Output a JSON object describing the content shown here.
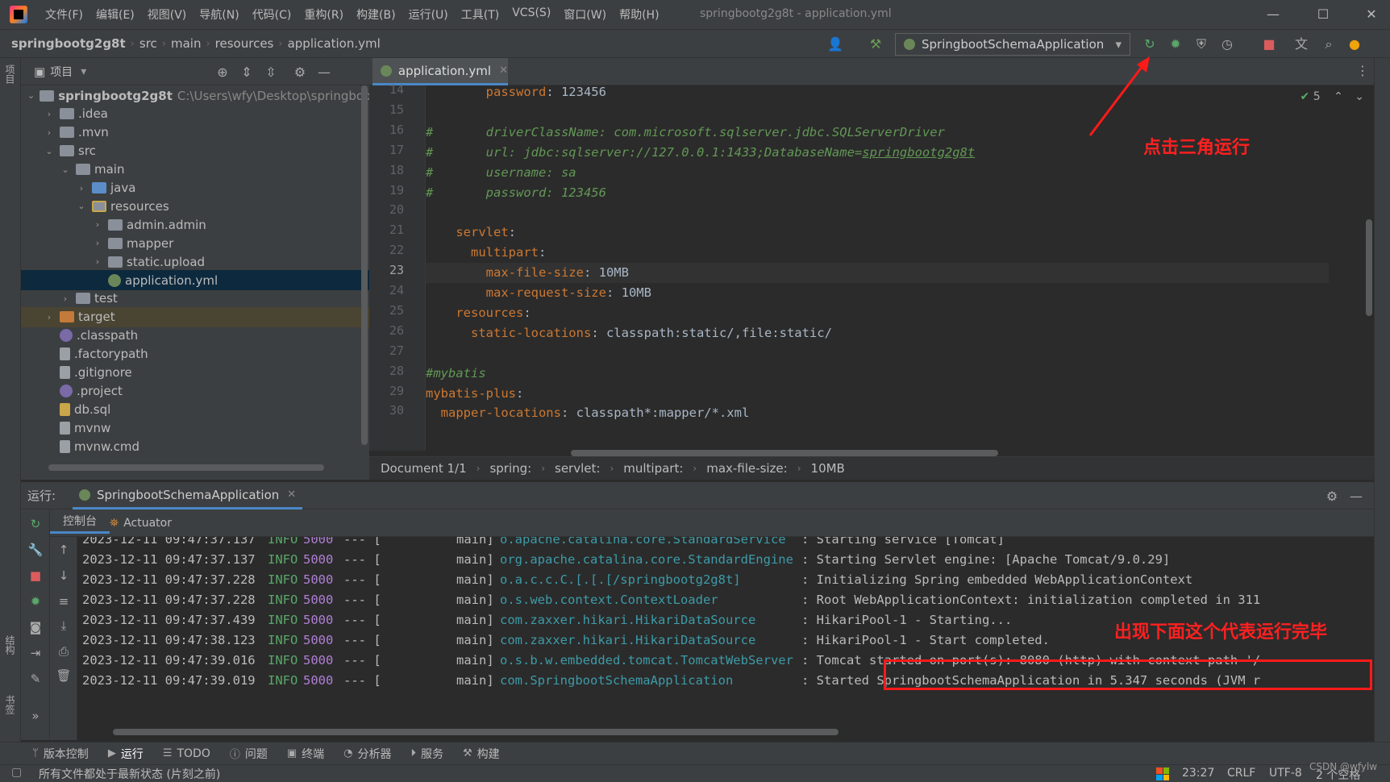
{
  "menu": {
    "items": [
      "文件(F)",
      "编辑(E)",
      "视图(V)",
      "导航(N)",
      "代码(C)",
      "重构(R)",
      "构建(B)",
      "运行(U)",
      "工具(T)",
      "VCS(S)",
      "窗口(W)",
      "帮助(H)"
    ],
    "window_title": "springbootg2g8t - application.yml"
  },
  "nav": {
    "crumbs": [
      "springbootg2g8t",
      "src",
      "main",
      "resources",
      "application.yml"
    ],
    "run_config": "SpringbootSchemaApplication"
  },
  "left_strip": {
    "tabs": [
      "项目",
      "结构",
      "书签"
    ]
  },
  "project": {
    "header": "项目",
    "tree": [
      {
        "label": "springbootg2g8t",
        "hint": "C:\\Users\\wfy\\Desktop\\springboot",
        "depth": 0,
        "open": true,
        "icon": "folder"
      },
      {
        "label": ".idea",
        "depth": 1,
        "open": false,
        "icon": "folder"
      },
      {
        "label": ".mvn",
        "depth": 1,
        "open": false,
        "icon": "folder"
      },
      {
        "label": "src",
        "depth": 1,
        "open": true,
        "icon": "folder"
      },
      {
        "label": "main",
        "depth": 2,
        "open": true,
        "icon": "folder"
      },
      {
        "label": "java",
        "depth": 3,
        "open": false,
        "icon": "folder-blue"
      },
      {
        "label": "resources",
        "depth": 3,
        "open": true,
        "icon": "folder-res"
      },
      {
        "label": "admin.admin",
        "depth": 4,
        "open": false,
        "icon": "folder"
      },
      {
        "label": "mapper",
        "depth": 4,
        "open": false,
        "icon": "folder"
      },
      {
        "label": "static.upload",
        "depth": 4,
        "open": false,
        "icon": "folder"
      },
      {
        "label": "application.yml",
        "depth": 4,
        "open": null,
        "icon": "file-yml",
        "selected": true
      },
      {
        "label": "test",
        "depth": 2,
        "open": false,
        "icon": "folder"
      },
      {
        "label": "target",
        "depth": 1,
        "open": false,
        "icon": "folder-orange",
        "highlight": true
      },
      {
        "label": ".classpath",
        "depth": 1,
        "open": null,
        "icon": "file-eclipse"
      },
      {
        "label": ".factorypath",
        "depth": 1,
        "open": null,
        "icon": "file-gen"
      },
      {
        "label": ".gitignore",
        "depth": 1,
        "open": null,
        "icon": "file-gen"
      },
      {
        "label": ".project",
        "depth": 1,
        "open": null,
        "icon": "file-eclipse"
      },
      {
        "label": "db.sql",
        "depth": 1,
        "open": null,
        "icon": "file-sql"
      },
      {
        "label": "mvnw",
        "depth": 1,
        "open": null,
        "icon": "file-gen"
      },
      {
        "label": "mvnw.cmd",
        "depth": 1,
        "open": null,
        "icon": "file-gen"
      }
    ]
  },
  "editor": {
    "tab": "application.yml",
    "inspection_count": "5",
    "lines": [
      {
        "n": "14",
        "parts": [
          [
            "k",
            "        password"
          ],
          [
            "v",
            ": 123456"
          ]
        ]
      },
      {
        "n": "15",
        "parts": []
      },
      {
        "n": "16",
        "parts": [
          [
            "c",
            "#       driverClassName: com.microsoft.sqlserver.jdbc.SQLServerDriver"
          ]
        ]
      },
      {
        "n": "17",
        "parts": [
          [
            "c",
            "#       url: jdbc:sqlserver://127.0.0.1:1433;DatabaseName="
          ],
          [
            "cu",
            "springbootg2g8t"
          ]
        ]
      },
      {
        "n": "18",
        "parts": [
          [
            "c",
            "#       username: sa"
          ]
        ]
      },
      {
        "n": "19",
        "parts": [
          [
            "c",
            "#       password: 123456"
          ]
        ]
      },
      {
        "n": "20",
        "parts": []
      },
      {
        "n": "21",
        "parts": [
          [
            "k",
            "    servlet"
          ],
          [
            "v",
            ":"
          ]
        ]
      },
      {
        "n": "22",
        "parts": [
          [
            "k",
            "      multipart"
          ],
          [
            "v",
            ":"
          ]
        ]
      },
      {
        "n": "23",
        "parts": [
          [
            "k",
            "        max-file-size"
          ],
          [
            "v",
            ": 10MB"
          ]
        ],
        "current": true
      },
      {
        "n": "24",
        "parts": [
          [
            "k",
            "        max-request-size"
          ],
          [
            "v",
            ": 10MB"
          ]
        ]
      },
      {
        "n": "25",
        "parts": [
          [
            "k",
            "    resources"
          ],
          [
            "v",
            ":"
          ]
        ]
      },
      {
        "n": "26",
        "parts": [
          [
            "k",
            "      static-locations"
          ],
          [
            "v",
            ": classpath:static/,file:static/"
          ]
        ]
      },
      {
        "n": "27",
        "parts": []
      },
      {
        "n": "28",
        "parts": [
          [
            "c",
            "#mybatis"
          ]
        ]
      },
      {
        "n": "29",
        "parts": [
          [
            "k",
            "mybatis-plus"
          ],
          [
            "v",
            ":"
          ]
        ]
      },
      {
        "n": "30",
        "parts": [
          [
            "k",
            "  mapper-locations"
          ],
          [
            "v",
            ": classpath*:mapper/*.xml"
          ]
        ]
      }
    ],
    "breadcrumb": [
      "Document 1/1",
      "spring:",
      "servlet:",
      "multipart:",
      "max-file-size:",
      "10MB"
    ]
  },
  "annotations": {
    "run_hint": "点击三角运行",
    "done_hint": "出现下面这个代表运行完毕"
  },
  "run": {
    "label": "运行:",
    "tab": "SpringbootSchemaApplication",
    "subtabs": [
      "控制台",
      "Actuator"
    ],
    "logs": [
      {
        "ts": "2023-12-11 09:47:37.137",
        "lvl": "INFO",
        "pid": "5000",
        "sep": "--- [",
        "thread": "main]",
        "cls": "o.apache.catalina.core.StandardService",
        "msg": ": Starting service [Tomcat]"
      },
      {
        "ts": "2023-12-11 09:47:37.137",
        "lvl": "INFO",
        "pid": "5000",
        "sep": "--- [",
        "thread": "main]",
        "cls": "org.apache.catalina.core.StandardEngine",
        "msg": ": Starting Servlet engine: [Apache Tomcat/9.0.29]"
      },
      {
        "ts": "2023-12-11 09:47:37.228",
        "lvl": "INFO",
        "pid": "5000",
        "sep": "--- [",
        "thread": "main]",
        "cls": "o.a.c.c.C.[.[.[/springbootg2g8t]",
        "msg": ": Initializing Spring embedded WebApplicationContext"
      },
      {
        "ts": "2023-12-11 09:47:37.228",
        "lvl": "INFO",
        "pid": "5000",
        "sep": "--- [",
        "thread": "main]",
        "cls": "o.s.web.context.ContextLoader",
        "msg": ": Root WebApplicationContext: initialization completed in 311"
      },
      {
        "ts": "2023-12-11 09:47:37.439",
        "lvl": "INFO",
        "pid": "5000",
        "sep": "--- [",
        "thread": "main]",
        "cls": "com.zaxxer.hikari.HikariDataSource",
        "msg": ": HikariPool-1 - Starting..."
      },
      {
        "ts": "2023-12-11 09:47:38.123",
        "lvl": "INFO",
        "pid": "5000",
        "sep": "--- [",
        "thread": "main]",
        "cls": "com.zaxxer.hikari.HikariDataSource",
        "msg": ": HikariPool-1 - Start completed."
      },
      {
        "ts": "2023-12-11 09:47:39.016",
        "lvl": "INFO",
        "pid": "5000",
        "sep": "--- [",
        "thread": "main]",
        "cls": "o.s.b.w.embedded.tomcat.TomcatWebServer",
        "msg": ": Tomcat started on port(s): 8080 (http) with context path '/"
      },
      {
        "ts": "2023-12-11 09:47:39.019",
        "lvl": "INFO",
        "pid": "5000",
        "sep": "--- [",
        "thread": "main]",
        "cls": "com.SpringbootSchemaApplication",
        "msg": ": Started SpringbootSchemaApplication in 5.347 seconds (JVM r"
      }
    ]
  },
  "bottom_tools": [
    {
      "label": "版本控制",
      "icon": "branch-icon",
      "glyph": "ᛘ"
    },
    {
      "label": "运行",
      "icon": "play-icon",
      "glyph": "▶",
      "active": true
    },
    {
      "label": "TODO",
      "icon": "list-icon",
      "glyph": "☰"
    },
    {
      "label": "问题",
      "icon": "problems-icon",
      "glyph": "ⓘ"
    },
    {
      "label": "终端",
      "icon": "terminal-icon",
      "glyph": "▣"
    },
    {
      "label": "分析器",
      "icon": "profiler-icon",
      "glyph": "◔"
    },
    {
      "label": "服务",
      "icon": "services-icon",
      "glyph": "⏵"
    },
    {
      "label": "构建",
      "icon": "hammer-icon",
      "glyph": "⚒"
    }
  ],
  "status": {
    "message": "所有文件都处于最新状态 (片刻之前)",
    "position": "23:27",
    "line_sep": "CRLF",
    "encoding": "UTF-8",
    "indent": "2 个空格"
  },
  "watermark": "CSDN @wfylw",
  "colors": {
    "keyword": "#cc7832",
    "comment": "#629755",
    "annotation": "#ff2020",
    "log_info": "#59a869",
    "log_class": "#3d9ba8"
  }
}
